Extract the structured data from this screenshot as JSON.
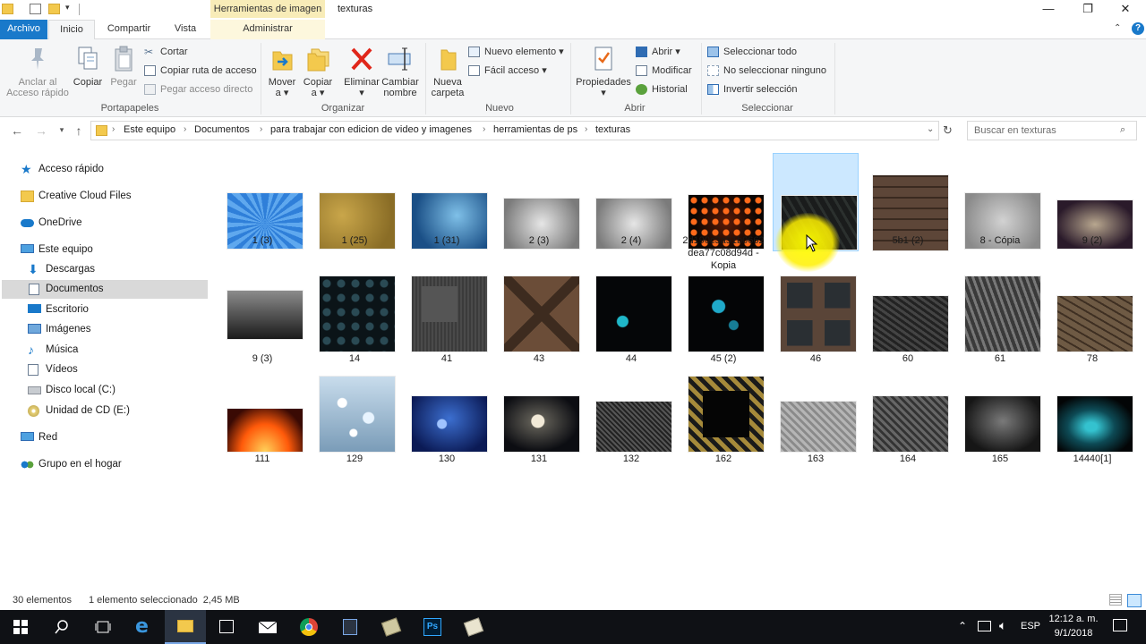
{
  "window": {
    "title": "texturas",
    "context_tab": "Herramientas de imagen"
  },
  "tabs": {
    "file": "Archivo",
    "home": "Inicio",
    "share": "Compartir",
    "view": "Vista",
    "manage": "Administrar"
  },
  "ribbon": {
    "clipboard": {
      "pin": "Anclar al\nAcceso rápido",
      "copy": "Copiar",
      "paste": "Pegar",
      "cut": "Cortar",
      "copy_path": "Copiar ruta de acceso",
      "paste_shortcut": "Pegar acceso directo",
      "label": "Portapapeles"
    },
    "organize": {
      "move_to": "Mover\na ▾",
      "copy_to": "Copiar\na ▾",
      "delete": "Eliminar\n▾",
      "rename": "Cambiar\nnombre",
      "label": "Organizar"
    },
    "new": {
      "new_folder": "Nueva\ncarpeta",
      "new_item": "Nuevo elemento ▾",
      "easy_access": "Fácil acceso ▾",
      "label": "Nuevo"
    },
    "open": {
      "properties": "Propiedades\n▾",
      "open": "Abrir ▾",
      "edit": "Modificar",
      "history": "Historial",
      "label": "Abrir"
    },
    "select": {
      "select_all": "Seleccionar todo",
      "select_none": "No seleccionar ninguno",
      "invert": "Invertir selección",
      "label": "Seleccionar"
    }
  },
  "address": {
    "crumbs": [
      "Este equipo",
      "Documentos",
      "para trabajar con edicion de video y imagenes",
      "herramientas de ps",
      "texturas"
    ],
    "search_placeholder": "Buscar en texturas"
  },
  "nav": {
    "quick_access": "Acceso rápido",
    "creative_cloud": "Creative Cloud Files",
    "onedrive": "OneDrive",
    "this_pc": "Este equipo",
    "downloads": "Descargas",
    "documents": "Documentos",
    "desktop": "Escritorio",
    "images": "Imágenes",
    "music": "Música",
    "videos": "Vídeos",
    "drive_c": "Disco local (C:)",
    "drive_e": "Unidad de CD (E:)",
    "network": "Red",
    "homegroup": "Grupo en el hogar"
  },
  "files": [
    {
      "name": "1 (3)",
      "style": "blue-rays"
    },
    {
      "name": "1 (25)",
      "style": "gold-grunge"
    },
    {
      "name": "1 (31)",
      "style": "blue-grunge"
    },
    {
      "name": "2 (3)",
      "style": "gray-grunge"
    },
    {
      "name": "2 (4)",
      "style": "gray-grunge"
    },
    {
      "name": "2d190c3a51b0662dea77c08d94d - Kopia",
      "style": "orange-dots"
    },
    {
      "name": "4 (2)",
      "style": "dark-stripes",
      "selected": true
    },
    {
      "name": "5b1 (2)",
      "style": "brick"
    },
    {
      "name": "8 - Cópia",
      "style": "cracked-gray"
    },
    {
      "name": "9 (2)",
      "style": "purple-vignette"
    },
    {
      "name": "9 (3)",
      "style": "dark-gradient"
    },
    {
      "name": "14",
      "style": "dark-teal-dots"
    },
    {
      "name": "41",
      "style": "metal-panel"
    },
    {
      "name": "43",
      "style": "wood-crate"
    },
    {
      "name": "44",
      "style": "neon-cyan"
    },
    {
      "name": "45 (2)",
      "style": "neon-gears"
    },
    {
      "name": "46",
      "style": "dark-windows"
    },
    {
      "name": "60",
      "style": "cracked-dark"
    },
    {
      "name": "61",
      "style": "cracked-dark2"
    },
    {
      "name": "78",
      "style": "cracked-earth"
    },
    {
      "name": "111",
      "style": "fire"
    },
    {
      "name": "129",
      "style": "bokeh-light"
    },
    {
      "name": "130",
      "style": "blue-bokeh"
    },
    {
      "name": "131",
      "style": "dark-bokeh"
    },
    {
      "name": "132",
      "style": "metal-mesh"
    },
    {
      "name": "162",
      "style": "hazard-frame"
    },
    {
      "name": "163",
      "style": "diamond-plate"
    },
    {
      "name": "164",
      "style": "diamond-plate-dark"
    },
    {
      "name": "165",
      "style": "dark-smoke"
    },
    {
      "name": "14440[1]",
      "style": "teal-smoke"
    }
  ],
  "status": {
    "count": "30 elementos",
    "selection": "1 elemento seleccionado  2,45 MB"
  },
  "taskbar": {
    "language": "ESP",
    "time": "12:12 a. m.",
    "date": "9/1/2018"
  },
  "colors": {
    "accent": "#1979ca",
    "selection": "#cce8ff",
    "taskbar": "#0f1115"
  }
}
